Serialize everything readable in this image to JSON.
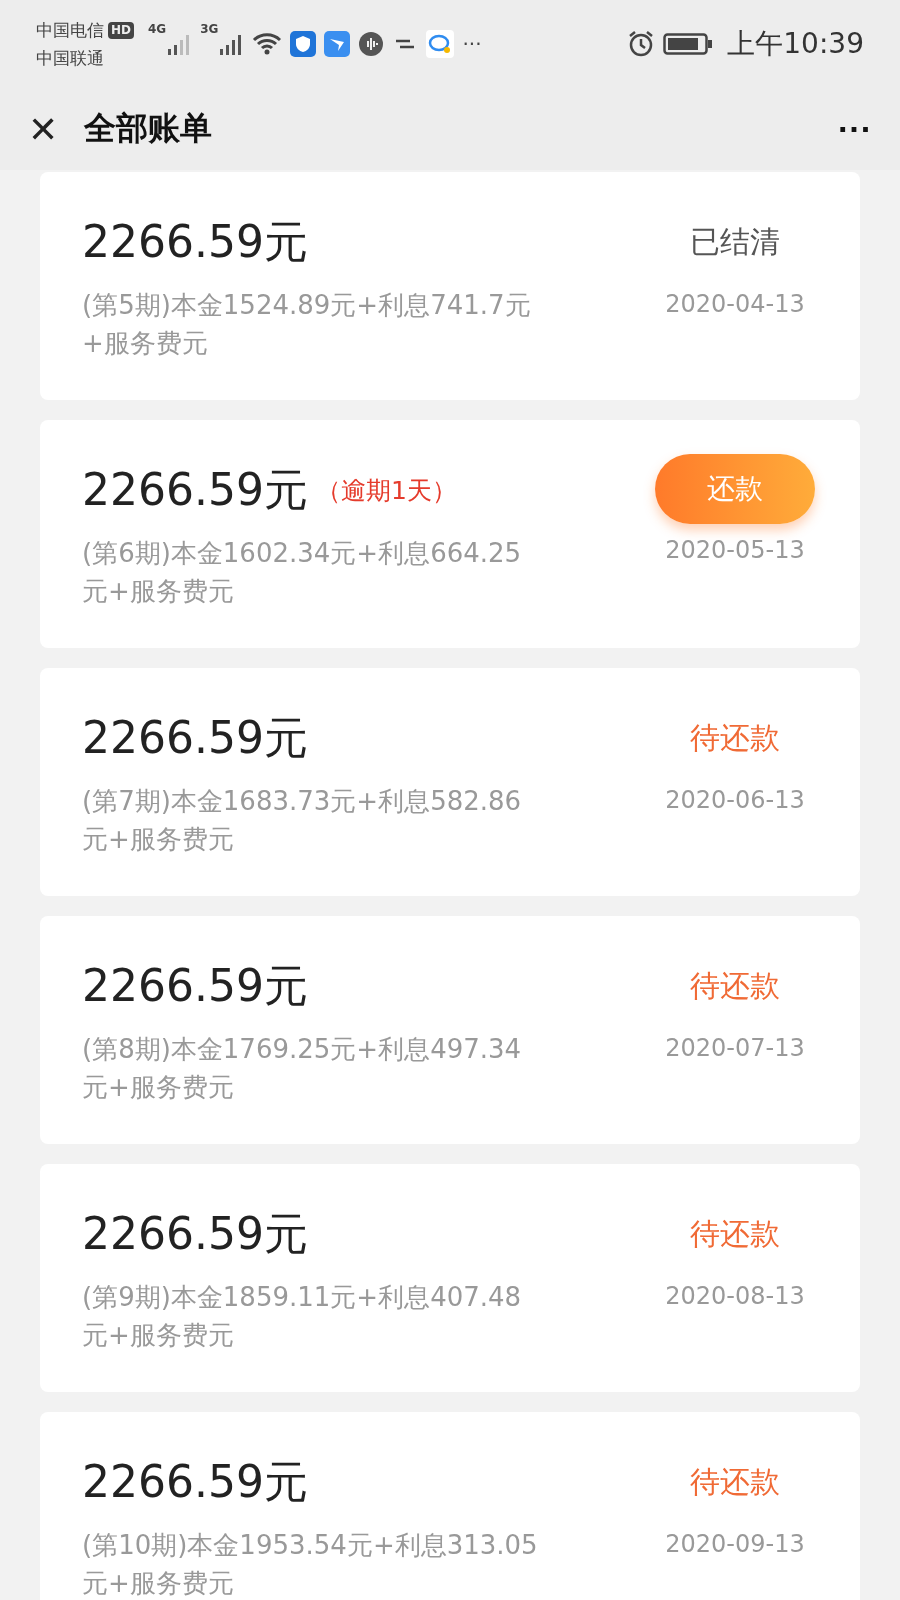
{
  "status_bar": {
    "carrier_1": "中国电信",
    "hd_badge": "HD",
    "carrier_2": "中国联通",
    "network_1": "4G",
    "network_2": "3G",
    "more": "···",
    "time": "上午10:39"
  },
  "header": {
    "close": "✕",
    "title": "全部账单",
    "more": "···"
  },
  "bills": [
    {
      "amount": "2266.59元",
      "kind": "settled",
      "status": "已结清",
      "detail": "(第5期)本金1524.89元+利息741.7元+服务费元",
      "date": "2020-04-13"
    },
    {
      "amount": "2266.59元",
      "note": "（逾期1天）",
      "kind": "button",
      "status": "还款",
      "detail": "(第6期)本金1602.34元+利息664.25元+服务费元",
      "date": "2020-05-13"
    },
    {
      "amount": "2266.59元",
      "kind": "text",
      "status": "待还款",
      "detail": "(第7期)本金1683.73元+利息582.86元+服务费元",
      "date": "2020-06-13"
    },
    {
      "amount": "2266.59元",
      "kind": "text",
      "status": "待还款",
      "detail": "(第8期)本金1769.25元+利息497.34元+服务费元",
      "date": "2020-07-13"
    },
    {
      "amount": "2266.59元",
      "kind": "text",
      "status": "待还款",
      "detail": "(第9期)本金1859.11元+利息407.48元+服务费元",
      "date": "2020-08-13"
    },
    {
      "amount": "2266.59元",
      "kind": "text",
      "status": "待还款",
      "detail": "(第10期)本金1953.54元+利息313.05元+服务费元",
      "date": "2020-09-13"
    }
  ]
}
